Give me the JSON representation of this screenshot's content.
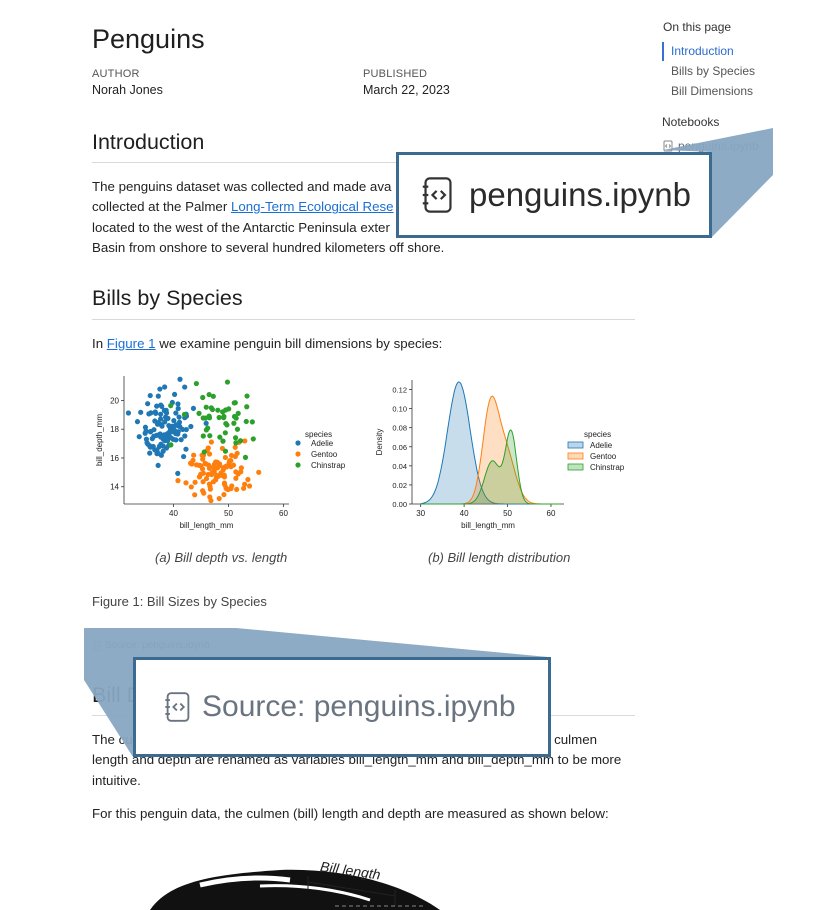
{
  "title": "Penguins",
  "meta": {
    "author_label": "AUTHOR",
    "author": "Norah Jones",
    "published_label": "PUBLISHED",
    "published": "March 22, 2023"
  },
  "intro": {
    "heading": "Introduction",
    "line1": "The penguins dataset was collected and made ava",
    "line2_pre": "collected at the Palmer ",
    "line2_link": "Long-Term Ecological Rese",
    "line3": "located to the west of the Antarctic Peninsula exter",
    "line4": "Basin from onshore to several hundred kilometers off shore."
  },
  "bills": {
    "heading": "Bills by Species",
    "para_pre": "In ",
    "para_link": "Figure 1",
    "para_post": " we examine penguin bill dimensions by species:",
    "caption_a": "(a) Bill depth vs. length",
    "caption_b": "(b) Bill length distribution",
    "figure_caption": "Figure 1: Bill Sizes by Species",
    "source_small": "Source: penguins.ipynb"
  },
  "dimensions": {
    "heading_visible": "Bill D",
    "para1_line1": "The cu",
    "para1_line1_end": "culmen",
    "para1_line2": "length and depth are renamed as variables bill_length_mm and bill_depth_mm to be more",
    "para1_line3": "intuitive.",
    "para2": "For this penguin data, the culmen (bill) length and depth are measured as shown below:",
    "illustration_label": "Bill length"
  },
  "toc": {
    "title": "On this page",
    "items": [
      "Introduction",
      "Bills by Species",
      "Bill Dimensions"
    ],
    "notebooks_title": "Notebooks",
    "notebook_item": "penguins.ipynb"
  },
  "callouts": {
    "notebook_zoom": "penguins.ipynb",
    "source_zoom": "Source: penguins.ipynb"
  },
  "colors": {
    "link": "#1a6fd6",
    "callout_border": "#3c6b91",
    "callout_fill": "#88a7c2",
    "adelie": "#1f77b4",
    "gentoo": "#ff7f0e",
    "chinstrap": "#2ca02c"
  },
  "chart_data": [
    {
      "type": "scatter",
      "xlabel": "bill_length_mm",
      "ylabel": "bill_depth_mm",
      "xticks": [
        "40",
        "50",
        "60"
      ],
      "yticks": [
        "14",
        "16",
        "18",
        "20"
      ],
      "xlim": [
        31,
        61
      ],
      "ylim": [
        12.8,
        21.7
      ],
      "legend_title": "species",
      "legend_position": "right",
      "series": [
        {
          "name": "Adelie",
          "color": "#1f77b4",
          "center": [
            38.8,
            18.3
          ],
          "spread": [
            2.6,
            1.2
          ],
          "count": 110
        },
        {
          "name": "Gentoo",
          "color": "#ff7f0e",
          "center": [
            47.5,
            15.0
          ],
          "spread": [
            3.0,
            1.0
          ],
          "count": 100
        },
        {
          "name": "Chinstrap",
          "color": "#2ca02c",
          "center": [
            48.8,
            18.4
          ],
          "spread": [
            3.3,
            1.1
          ],
          "count": 50
        }
      ]
    },
    {
      "type": "area",
      "xlabel": "bill_length_mm",
      "ylabel": "Density",
      "xticks": [
        "30",
        "40",
        "50",
        "60"
      ],
      "yticks": [
        "0.00",
        "0.02",
        "0.04",
        "0.06",
        "0.08",
        "0.10",
        "0.12"
      ],
      "xlim": [
        28,
        63
      ],
      "ylim": [
        0,
        0.13
      ],
      "legend_title": "species",
      "legend_position": "right",
      "series": [
        {
          "name": "Adelie",
          "color": "#1f77b4",
          "components": [
            [
              38.8,
              2.6,
              0.128
            ]
          ]
        },
        {
          "name": "Gentoo",
          "color": "#ff7f0e",
          "components": [
            [
              46.0,
              1.8,
              0.095
            ],
            [
              49.5,
              2.2,
              0.055
            ]
          ]
        },
        {
          "name": "Chinstrap",
          "color": "#2ca02c",
          "components": [
            [
              50.8,
              1.3,
              0.075
            ],
            [
              46.5,
              1.8,
              0.045
            ]
          ]
        }
      ]
    }
  ]
}
